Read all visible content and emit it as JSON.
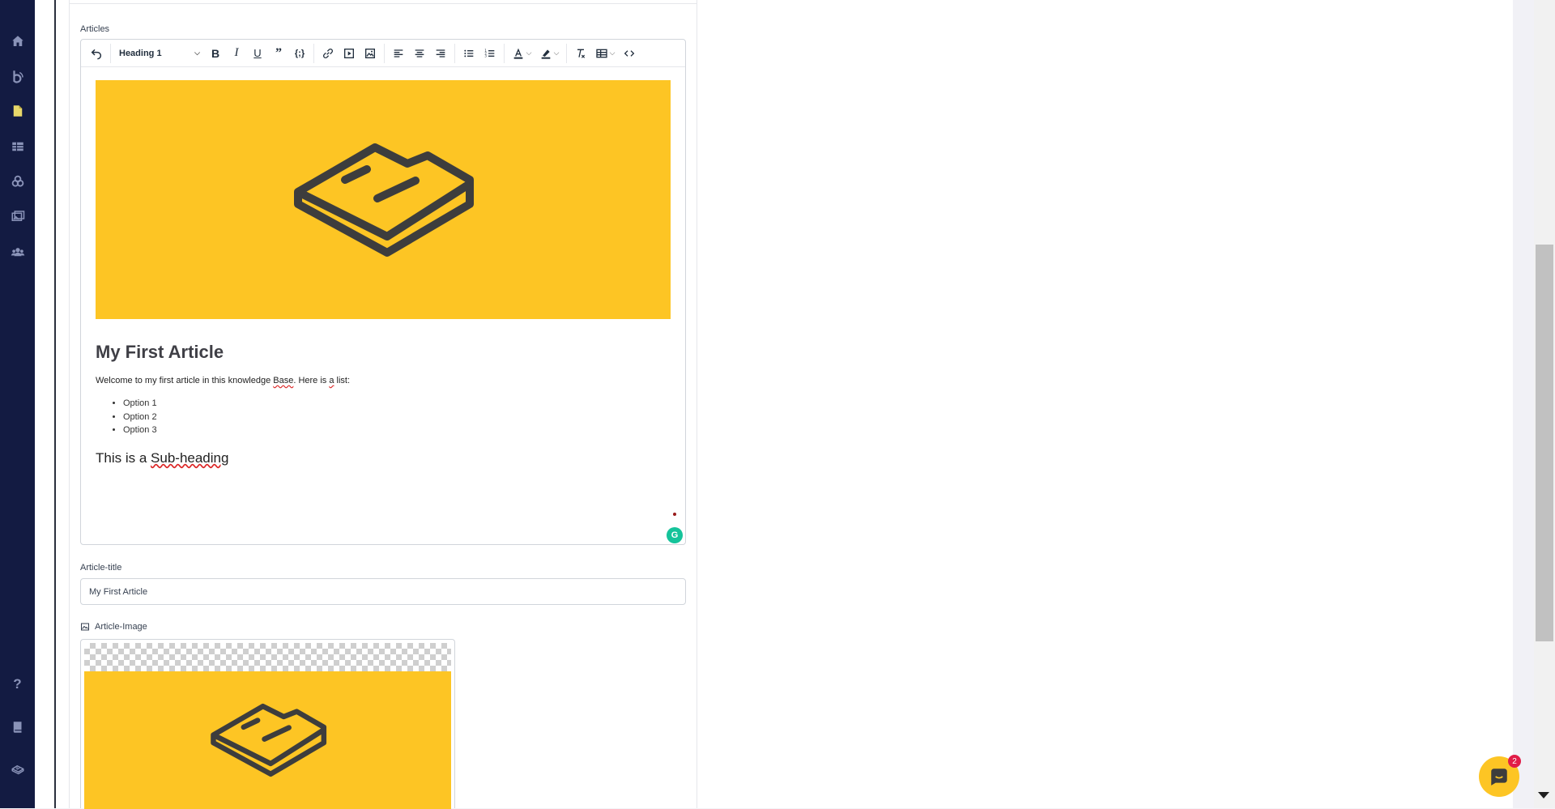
{
  "sidebar": {
    "items": [
      {
        "icon": "home-icon"
      },
      {
        "icon": "knowledge-base-icon"
      },
      {
        "icon": "article-icon"
      },
      {
        "icon": "table-icon"
      },
      {
        "icon": "components-icon"
      },
      {
        "icon": "media-icon"
      },
      {
        "icon": "users-icon"
      }
    ],
    "bottom": [
      {
        "icon": "help-icon",
        "glyph": "?"
      },
      {
        "icon": "book-icon"
      },
      {
        "icon": "logo-icon"
      }
    ]
  },
  "form": {
    "articles_label": "Articles",
    "title_label": "Article-title",
    "title_value": "My First Article",
    "image_label": "Article-Image"
  },
  "toolbar": {
    "block_format": "Heading 1",
    "buttons": [
      "undo",
      "bold",
      "italic",
      "underline",
      "blockquote",
      "code",
      "link",
      "media",
      "image",
      "align-left",
      "align-center",
      "align-right",
      "bullet-list",
      "number-list",
      "text-color",
      "highlight",
      "clear-format",
      "table",
      "source-code"
    ]
  },
  "article": {
    "heading": "My First Article",
    "intro_before": "Welcome to my first article in this knowledge ",
    "intro_base": "Base",
    "intro_mid": ". Here is ",
    "intro_a": "a",
    "intro_end": " list:",
    "list": [
      "Option 1",
      "Option 2",
      "Option 3"
    ],
    "subheading_before": "This is a ",
    "subheading_word": "Sub-heading"
  },
  "chat": {
    "badge_count": "2"
  },
  "colors": {
    "sidebar": "#131b42",
    "brand_yellow": "#fdc524",
    "logo_dark": "#3d3d3d",
    "grammarly": "#15c39a",
    "badge": "#e11d48"
  }
}
